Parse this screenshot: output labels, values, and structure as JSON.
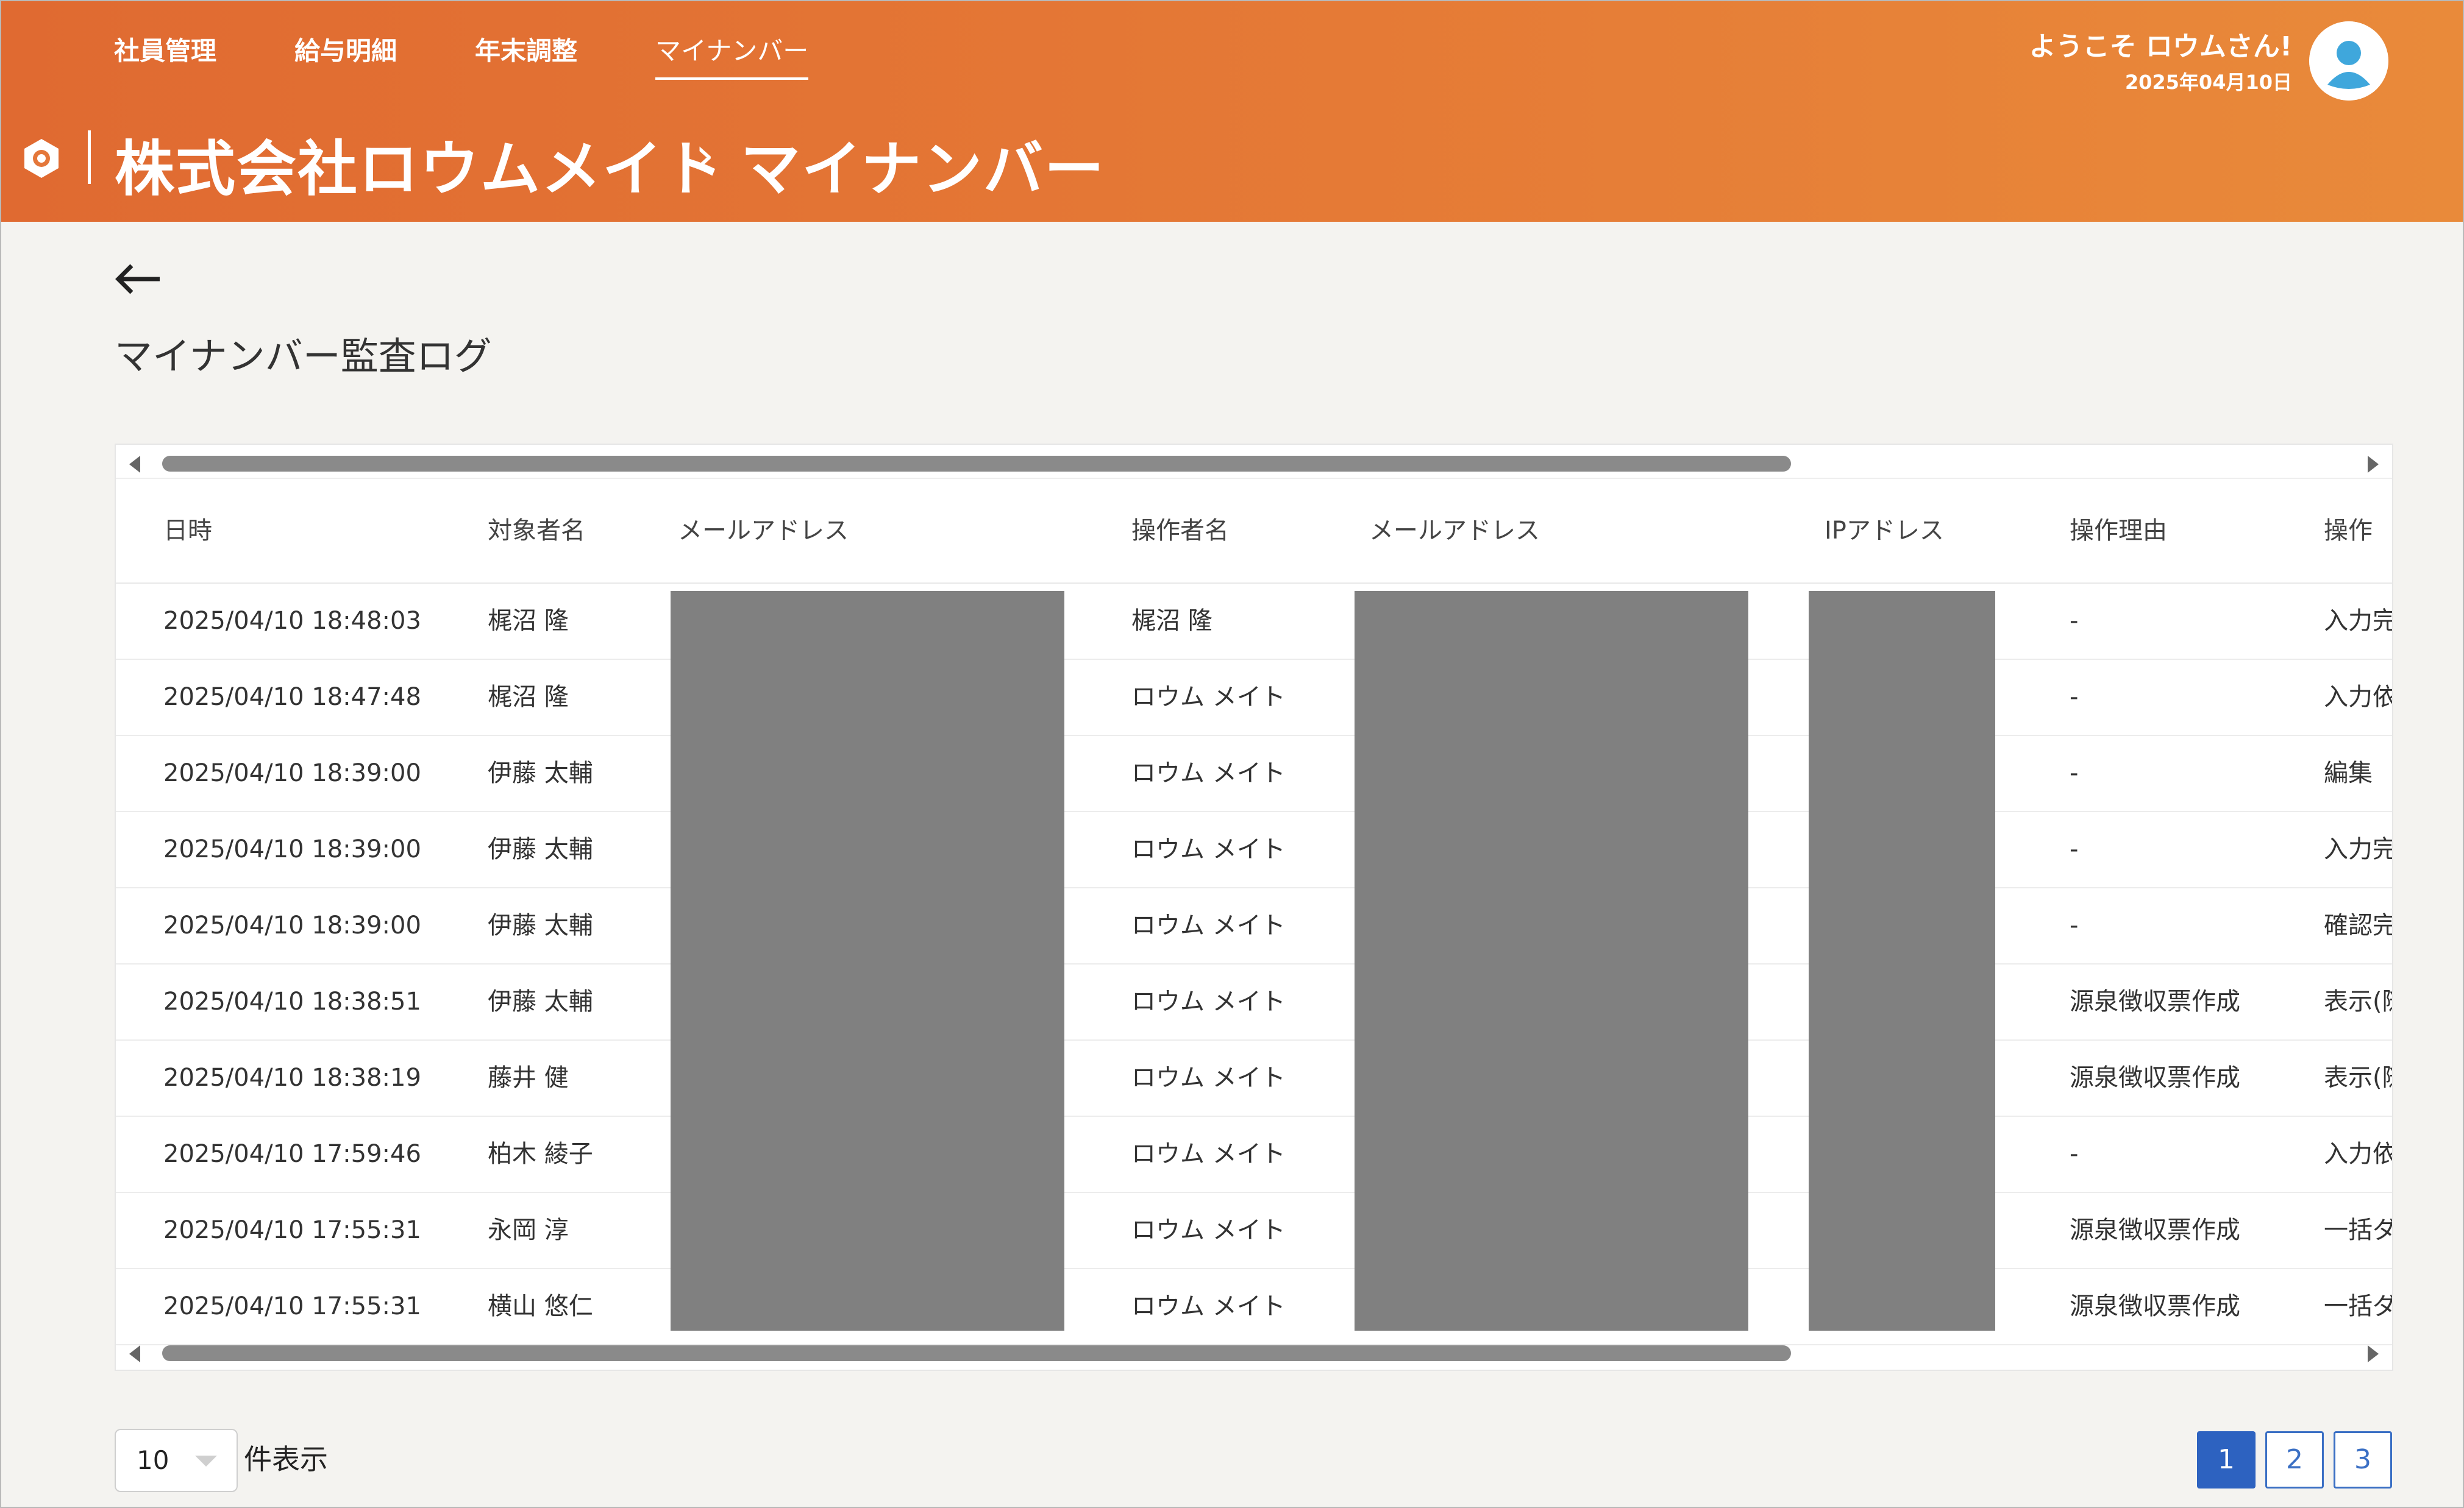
{
  "header": {
    "nav": [
      "社員管理",
      "給与明細",
      "年末調整",
      "マイナンバー"
    ],
    "company": "株式会社ロウムメイト",
    "separator": "›",
    "section": "マイナンバー",
    "welcome": "ようこそ ロウムさん!",
    "date": "2025年04月10日"
  },
  "page": {
    "back_icon": "arrow-left-icon",
    "title": "マイナンバー監査ログ"
  },
  "table": {
    "columns": [
      "日時",
      "対象者名",
      "メールアドレス",
      "操作者名",
      "メールアドレス",
      "IPアドレス",
      "操作理由",
      "操作"
    ],
    "rows": [
      {
        "date": "2025/04/10 18:48:03",
        "target": "梶沼 隆",
        "operator": "梶沼 隆",
        "reason": "-",
        "action": "入力完"
      },
      {
        "date": "2025/04/10 18:47:48",
        "target": "梶沼 隆",
        "operator": "ロウム メイト",
        "reason": "-",
        "action": "入力依"
      },
      {
        "date": "2025/04/10 18:39:00",
        "target": "伊藤 太輔",
        "operator": "ロウム メイト",
        "reason": "-",
        "action": "編集"
      },
      {
        "date": "2025/04/10 18:39:00",
        "target": "伊藤 太輔",
        "operator": "ロウム メイト",
        "reason": "-",
        "action": "入力完"
      },
      {
        "date": "2025/04/10 18:39:00",
        "target": "伊藤 太輔",
        "operator": "ロウム メイト",
        "reason": "-",
        "action": "確認完"
      },
      {
        "date": "2025/04/10 18:38:51",
        "target": "伊藤 太輔",
        "operator": "ロウム メイト",
        "reason": "源泉徴収票作成",
        "action": "表示(随"
      },
      {
        "date": "2025/04/10 18:38:19",
        "target": "藤井 健",
        "operator": "ロウム メイト",
        "reason": "源泉徴収票作成",
        "action": "表示(随"
      },
      {
        "date": "2025/04/10 17:59:46",
        "target": "柏木 綾子",
        "operator": "ロウム メイト",
        "reason": "-",
        "action": "入力依"
      },
      {
        "date": "2025/04/10 17:55:31",
        "target": "永岡 淳",
        "operator": "ロウム メイト",
        "reason": "源泉徴収票作成",
        "action": "一括ダ"
      },
      {
        "date": "2025/04/10 17:55:31",
        "target": "横山 悠仁",
        "operator": "ロウム メイト",
        "reason": "源泉徴収票作成",
        "action": "一括ダ"
      }
    ]
  },
  "footer": {
    "per_page_value": "10",
    "per_page_label": "件表示",
    "pages": [
      "1",
      "2",
      "3"
    ],
    "current_page": "1"
  },
  "colors": {
    "header_start": "#e06a31",
    "header_end": "#e98a3a",
    "pager_active": "#2d62c0",
    "redaction": "#808080"
  }
}
